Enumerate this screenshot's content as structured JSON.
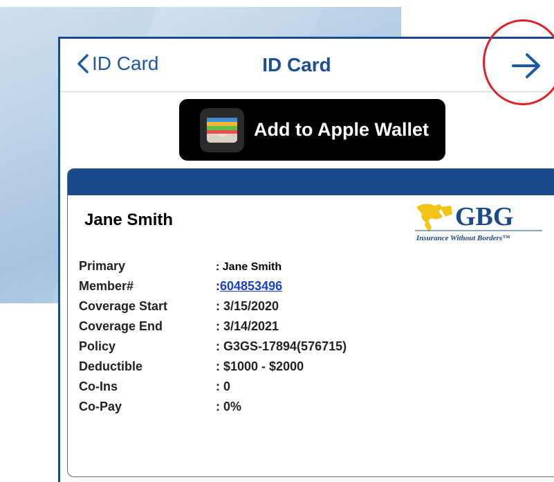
{
  "nav": {
    "back_label": "ID Card",
    "title": "ID Card"
  },
  "wallet": {
    "label": "Add to Apple Wallet"
  },
  "card": {
    "name": "Jane Smith",
    "logo": {
      "text": "GBG",
      "tagline": "Insurance Without Borders"
    },
    "rows": [
      {
        "label": "Primary",
        "value": ":  Jane Smith"
      },
      {
        "label": "Member#",
        "value_prefix": ": ",
        "value": "604853496"
      },
      {
        "label": "Coverage Start",
        "value": ": 3/15/2020"
      },
      {
        "label": "Coverage End",
        "value": ": 3/14/2021"
      },
      {
        "label": "Policy",
        "value": ": G3GS-17894(576715)"
      },
      {
        "label": "Deductible",
        "value": ": $1000 - $2000"
      },
      {
        "label": "Co-Ins",
        "value": ": 0"
      },
      {
        "label": "Co-Pay",
        "value": ": 0%"
      }
    ]
  },
  "colors": {
    "accent": "#1b4a8a",
    "link": "#1a3fd1",
    "highlight": "#e31e24"
  }
}
